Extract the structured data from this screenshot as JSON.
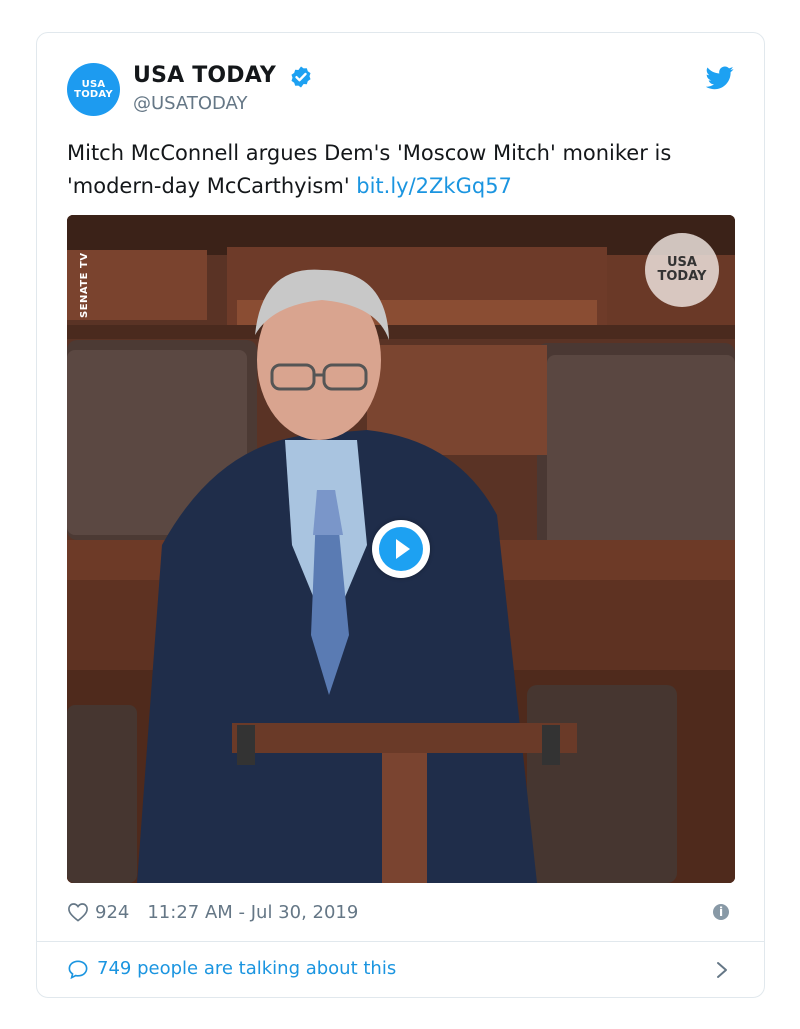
{
  "author": {
    "avatar_line1": "USA",
    "avatar_line2": "TODAY",
    "display_name": "USA TODAY",
    "handle": "@USATODAY"
  },
  "tweet": {
    "text": "Mitch McConnell argues Dem's 'Moscow Mitch' moniker is 'modern-day McCarthyism' ",
    "link": "bit.ly/2ZkGq57"
  },
  "media": {
    "overlay_label": "SENATE TV",
    "watermark_line1": "USA",
    "watermark_line2": "TODAY"
  },
  "meta": {
    "likes": "924",
    "timestamp": "11:27 AM - Jul 30, 2019"
  },
  "footer": {
    "conversation": "749 people are talking about this"
  },
  "icons": {
    "verified": "verified-badge-icon",
    "brand": "twitter-bird-icon",
    "like": "heart-icon",
    "info": "info-icon",
    "reply": "speech-bubble-icon",
    "expand": "chevron-right-icon",
    "play": "play-icon"
  },
  "colors": {
    "brand_blue": "#1da1f2",
    "link": "#1b95e0",
    "secondary_text": "#657786"
  }
}
